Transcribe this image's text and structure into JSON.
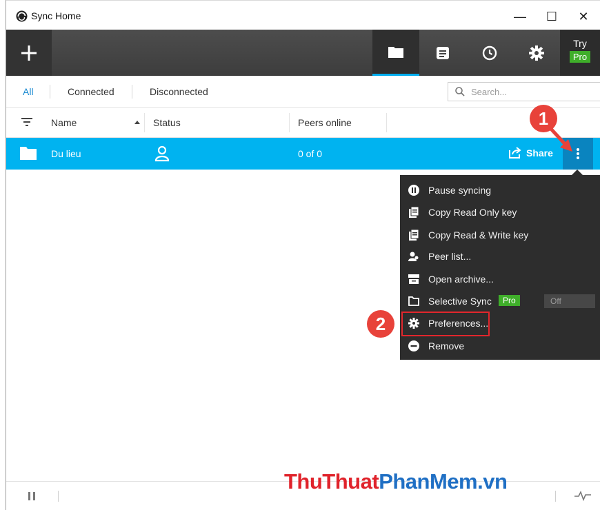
{
  "window": {
    "title": "Sync Home",
    "minimize_glyph": "—",
    "maximize_glyph": "☐",
    "close_glyph": "✕"
  },
  "toolbar": {
    "add_icon": "plus-icon",
    "tabs": [
      {
        "icon": "folder-icon",
        "active": true
      },
      {
        "icon": "log-icon",
        "active": false
      },
      {
        "icon": "history-icon",
        "active": false
      },
      {
        "icon": "gear-icon",
        "active": false
      }
    ],
    "try_label": "Try",
    "pro_label": "Pro"
  },
  "filters": {
    "all": "All",
    "connected": "Connected",
    "disconnected": "Disconnected",
    "search_placeholder": "Search..."
  },
  "columns": {
    "name": "Name",
    "status": "Status",
    "peers": "Peers online"
  },
  "folders": [
    {
      "name": "Du lieu",
      "peers": "0 of 0",
      "share_label": "Share"
    }
  ],
  "menu": {
    "items": [
      {
        "label": "Pause syncing",
        "icon": "pause-circle-icon"
      },
      {
        "label": "Copy Read Only key",
        "icon": "copy-icon"
      },
      {
        "label": "Copy Read & Write key",
        "icon": "copy-icon"
      },
      {
        "label": "Peer list...",
        "icon": "peers-icon"
      },
      {
        "label": "Open archive...",
        "icon": "archive-icon"
      },
      {
        "label": "Selective Sync",
        "icon": "folder-outline-icon",
        "badge": "Pro",
        "toggle": "Off"
      },
      {
        "label": "Preferences...",
        "icon": "gear-icon"
      },
      {
        "label": "Remove",
        "icon": "remove-circle-icon"
      }
    ]
  },
  "annotations": {
    "marker1": "1",
    "marker2": "2"
  },
  "watermark": {
    "part1": "ThuThuat",
    "part2": "PhanMem",
    "part3": ".vn"
  },
  "colors": {
    "accent": "#00b3f0",
    "toolbar": "#444444",
    "menu": "#2d2d2d",
    "pro_green": "#3fae2a",
    "marker_red": "#e8423a"
  }
}
